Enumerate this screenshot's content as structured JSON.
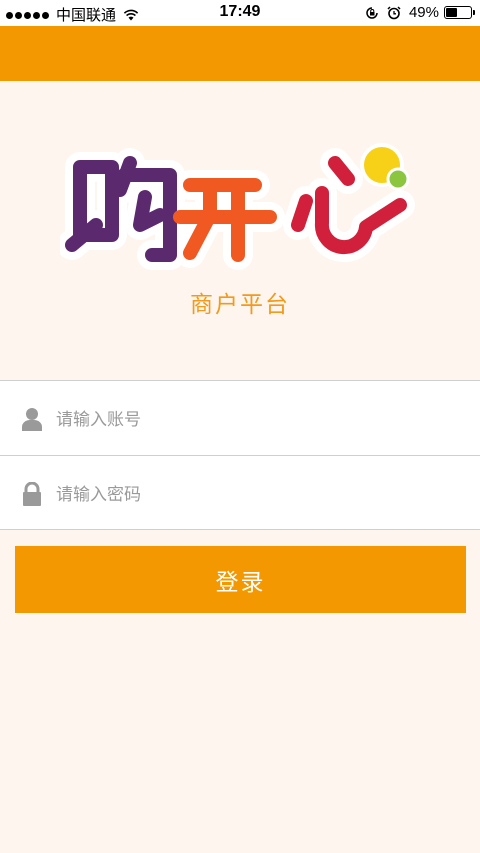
{
  "status_bar": {
    "carrier": "中国联通",
    "time": "17:49",
    "battery_percent": "49%",
    "battery_level": 0.49
  },
  "logo": {
    "text": "购开心",
    "colors": {
      "purple": "#5b2a6e",
      "orange": "#f05a22",
      "red": "#d1203c",
      "yellow": "#f7d117",
      "green": "#8cc63f"
    }
  },
  "subtitle": "商户平台",
  "form": {
    "account_placeholder": "请输入账号",
    "account_value": "",
    "password_placeholder": "请输入密码",
    "password_value": "",
    "login_label": "登录"
  },
  "theme": {
    "accent": "#f39800",
    "background": "#fdf5ee",
    "icon": "#9a9a9a"
  },
  "icons": [
    "signal-dots-icon",
    "wifi-icon",
    "rotation-lock-icon",
    "alarm-icon",
    "battery-icon",
    "user-icon",
    "lock-icon"
  ]
}
